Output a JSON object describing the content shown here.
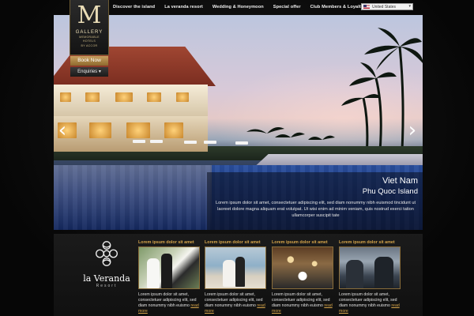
{
  "nav": {
    "items": [
      "Discover the island",
      "La veranda resort",
      "Wedding & Honeymoon",
      "Special offer",
      "Club Members & Loyalty Cards"
    ],
    "language": "United States"
  },
  "logo": {
    "mark": "M",
    "brand": "GALLERY",
    "tagline_1": "MEMORABLE",
    "tagline_2": "HOTELS",
    "tagline_3": "BY ACCOR"
  },
  "buttons": {
    "book": "Book Now",
    "enquiries": "Enquiries"
  },
  "hero": {
    "title": "Viet Nam",
    "subtitle": "Phu Quoc Island",
    "text": "Lorem ipsum dolor sit amet, consectetuer adipiscing elit, sed diam nonummy nibh euismod tincidunt ut laoreet dolore magna aliquam erat volutpat. Ut wisi enim ad minim veniam, quis nostrud exerci tation ullamcorper suscipit tate",
    "prev_arrow": "‹",
    "next_arrow": "›"
  },
  "resort": {
    "name": "la Veranda",
    "sub": "Resort"
  },
  "cards": [
    {
      "title": "Lorem ipsum dolor sit amet",
      "text": "Lorem ipsum dolor sit amet, consectetuer adipiscing elit, sed diam nonummy nibh euismo",
      "more": "read more"
    },
    {
      "title": "Lorem ipsum dolor sit amet",
      "text": "Lorem ipsum dolor sit amet, consectetuer adipiscing elit, sed diam nonummy nibh euismo",
      "more": "read more"
    },
    {
      "title": "Lorem ipsum dolor sit amet",
      "text": "Lorem ipsum dolor sit amet, consectetuer adipiscing elit, sed diam nonummy nibh euismo",
      "more": "read more"
    },
    {
      "title": "Lorem ipsum dolor sit amet",
      "text": "Lorem ipsum dolor sit amet, consectetuer adipiscing elit, sed diam nonummy nibh euismo",
      "more": "read more"
    }
  ],
  "colors": {
    "accent_gold": "#d6a54b",
    "background": "#0b0b0b",
    "pool_blue": "#1d3a82"
  }
}
